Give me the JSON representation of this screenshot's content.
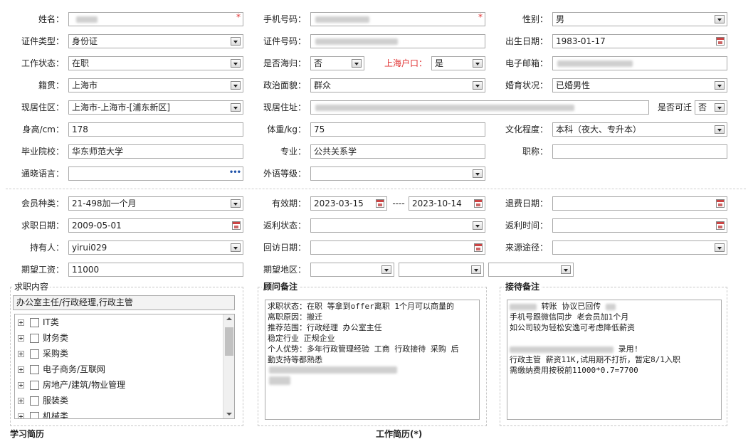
{
  "basic": {
    "name": {
      "label": "姓名："
    },
    "phone": {
      "label": "手机号码："
    },
    "gender": {
      "label": "性别：",
      "value": "男"
    },
    "id_type": {
      "label": "证件类型：",
      "value": "身份证"
    },
    "id_no": {
      "label": "证件号码："
    },
    "birth": {
      "label": "出生日期：",
      "value": "1983-01-17"
    },
    "work_status": {
      "label": "工作状态：",
      "value": "在职"
    },
    "returnee": {
      "label": "是否海归：",
      "value": "否"
    },
    "shanghai_hukou": {
      "label": "上海户口：",
      "value": "是"
    },
    "email": {
      "label": "电子邮箱："
    },
    "native": {
      "label": "籍贯：",
      "value": "上海市"
    },
    "political": {
      "label": "政治面貌：",
      "value": "群众"
    },
    "marital": {
      "label": "婚育状况：",
      "value": "已婚男性"
    },
    "residence_area": {
      "label": "现居住区：",
      "value": "上海市-上海市-[浦东新区]"
    },
    "address": {
      "label": "现居住址："
    },
    "relocate": {
      "label": "是否可迁",
      "value": "否"
    },
    "height": {
      "label": "身高/cm：",
      "value": "178"
    },
    "weight": {
      "label": "体重/kg：",
      "value": "75"
    },
    "education": {
      "label": "文化程度：",
      "value": "本科（夜大、专升本）"
    },
    "school": {
      "label": "毕业院校：",
      "value": "华东师范大学"
    },
    "major": {
      "label": "专业：",
      "value": "公共关系学"
    },
    "title": {
      "label": "职称：",
      "value": ""
    },
    "language": {
      "label": "通晓语言：",
      "value": ""
    },
    "foreign_level": {
      "label": "外语等级：",
      "value": ""
    }
  },
  "member": {
    "type": {
      "label": "会员种类：",
      "value": "21-498加一个月"
    },
    "valid": {
      "label": "有效期：",
      "from": "2023-03-15",
      "sep": "----",
      "to": "2023-10-14"
    },
    "refund_date": {
      "label": "退费日期：",
      "value": ""
    },
    "job_date": {
      "label": "求职日期：",
      "value": "2009-05-01"
    },
    "rebate_status": {
      "label": "返利状态：",
      "value": ""
    },
    "rebate_time": {
      "label": "返利时间：",
      "value": ""
    },
    "holder": {
      "label": "持有人：",
      "value": "yirui029"
    },
    "visit_date": {
      "label": "回访日期：",
      "value": ""
    },
    "source": {
      "label": "来源途径：",
      "value": ""
    },
    "salary": {
      "label": "期望工资：",
      "value": "11000"
    },
    "region": {
      "label": "期望地区：",
      "value": ""
    }
  },
  "job_content": {
    "title": "求职内容",
    "selected": "办公室主任/行政经理,行政主管",
    "categories": [
      "IT类",
      "财务类",
      "采购类",
      "电子商务/互联网",
      "房地产/建筑/物业管理",
      "服装类",
      "机械类"
    ]
  },
  "advisor_note": {
    "title": "顾问备注",
    "lines": [
      "求职状态：在职 等拿到offer离职 1个月可以商量的",
      "离职原因：搬迁",
      "推荐范围：行政经理 办公室主任",
      "稳定行业 正规企业",
      "个人优势：多年行政管理经验 工商 行政接待 采购 后",
      "勤支持等都熟悉"
    ]
  },
  "reception_note": {
    "title": "接待备注",
    "line1": "转账 协议已回传",
    "lines_a": [
      "手机号跟微信同步  老会员加1个月",
      "如公司较为轻松安逸可考虑降低薪资"
    ],
    "line_hired": "录用!",
    "lines_b": [
      "行政主管 薪资11K,试用期不打折，暂定8/1入职",
      "需缴纳费用按税前11000*0.7=7700"
    ]
  },
  "bottom": {
    "study": "学习简历",
    "work": "工作简历(*)"
  }
}
